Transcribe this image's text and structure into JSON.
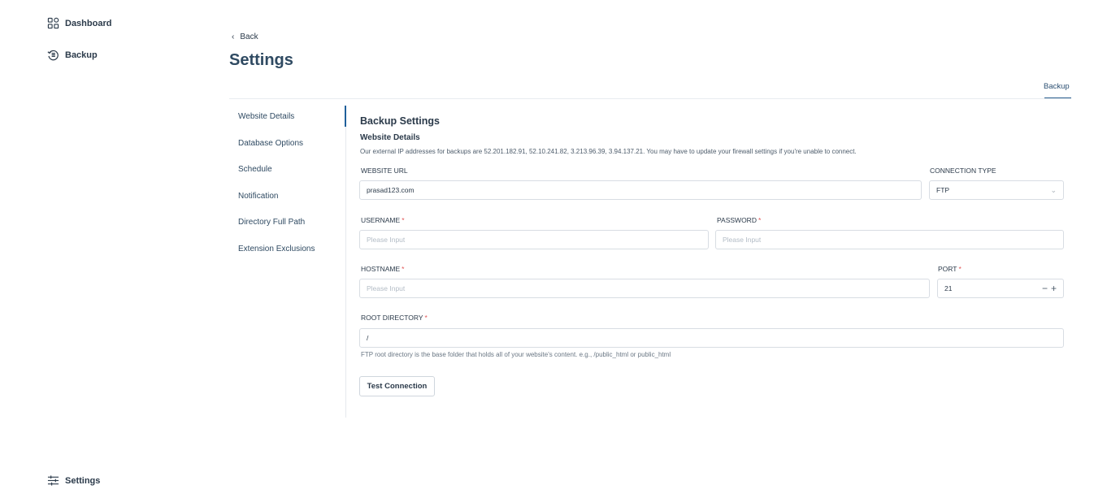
{
  "nav": {
    "dashboard": "Dashboard",
    "backup": "Backup",
    "settings": "Settings"
  },
  "header": {
    "back": "Back",
    "title": "Settings",
    "tab": "Backup"
  },
  "side_tabs": [
    "Website Details",
    "Database Options",
    "Schedule",
    "Notification",
    "Directory Full Path",
    "Extension Exclusions"
  ],
  "form": {
    "section_title": "Backup Settings",
    "subtitle": "Website Details",
    "info": "Our external IP addresses for backups are 52.201.182.91, 52.10.241.82, 3.213.96.39, 3.94.137.21. You may have to update your firewall settings if you're unable to connect.",
    "website_url": {
      "label": "WEBSITE URL",
      "value": "prasad123.com"
    },
    "connection_type": {
      "label": "CONNECTION TYPE",
      "value": "FTP"
    },
    "username": {
      "label": "USERNAME",
      "placeholder": "Please Input"
    },
    "password": {
      "label": "PASSWORD",
      "placeholder": "Please Input"
    },
    "hostname": {
      "label": "HOSTNAME",
      "placeholder": "Please Input"
    },
    "port": {
      "label": "PORT",
      "value": "21"
    },
    "root_directory": {
      "label": "ROOT DIRECTORY",
      "value": "/"
    },
    "required_mark": "*",
    "hint": "FTP root directory is the base folder that holds all of your website's content. e.g., /public_html or public_html",
    "test_button": "Test Connection"
  },
  "colors": {
    "accent": "#1f5f9a",
    "required": "#e05555"
  },
  "icons": {
    "dashboard": "grid-icon",
    "backup": "backup-icon",
    "settings": "sliders-icon",
    "back": "chevron-left-icon"
  }
}
